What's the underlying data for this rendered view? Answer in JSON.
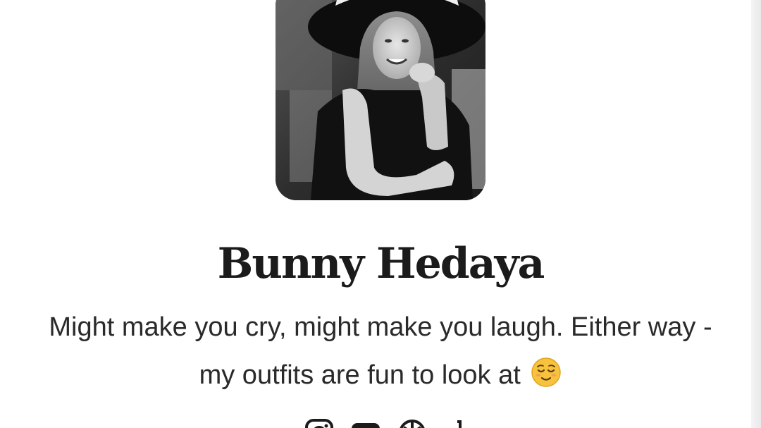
{
  "profile": {
    "name": "Bunny Hedaya",
    "bio": "Might make you cry, might make you laugh. Either way - my outfits are fun to look at",
    "bio_emoji": "relieved-face-emoji",
    "avatar_icon": "profile-photo"
  },
  "socials": [
    {
      "icon": "instagram-icon"
    },
    {
      "icon": "youtube-icon"
    },
    {
      "icon": "ltk-icon"
    },
    {
      "icon": "tiktok-icon"
    }
  ],
  "colors": {
    "text": "#1b1b1b",
    "background": "#ffffff",
    "emoji": "#f7c23c"
  }
}
